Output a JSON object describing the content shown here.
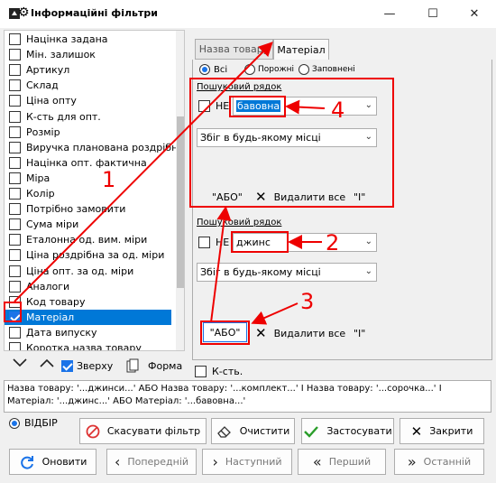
{
  "window": {
    "title": "Інформаційні фільтри",
    "controls": [
      "—",
      "☐",
      "✕"
    ]
  },
  "field_list": {
    "items": [
      {
        "label": "Націнка задана",
        "checked": false
      },
      {
        "label": "Мін. залишок",
        "checked": false
      },
      {
        "label": "Артикул",
        "checked": false
      },
      {
        "label": "Склад",
        "checked": false
      },
      {
        "label": "Ціна опту",
        "checked": false
      },
      {
        "label": "К-сть для опт.",
        "checked": false
      },
      {
        "label": "Розмір",
        "checked": false
      },
      {
        "label": "Виручка планована роздрібна з",
        "checked": false
      },
      {
        "label": "Націнка опт. фактична",
        "checked": false
      },
      {
        "label": "Міра",
        "checked": false
      },
      {
        "label": "Колір",
        "checked": false
      },
      {
        "label": "Потрібно замовити",
        "checked": false
      },
      {
        "label": "Сума міри",
        "checked": false
      },
      {
        "label": "Еталонна од. вим. міри",
        "checked": false
      },
      {
        "label": "Ціна роздрібна за од. міри",
        "checked": false
      },
      {
        "label": "Ціна опт. за од. міри",
        "checked": false
      },
      {
        "label": "Аналоги",
        "checked": false
      },
      {
        "label": "Код товару",
        "checked": false
      },
      {
        "label": "Матеріал",
        "checked": true,
        "selected": true
      },
      {
        "label": "Дата випуску",
        "checked": false
      },
      {
        "label": "Коротка назва товару",
        "checked": false
      }
    ]
  },
  "list_toolbar": {
    "up_icon": "chevron-up-icon",
    "down_icon": "chevron-down-icon",
    "top_label": "Зверху",
    "top_checked": true,
    "form_label": "Форма"
  },
  "tabs": [
    {
      "label": "Назва товару",
      "active": false
    },
    {
      "label": "Матеріал",
      "active": true
    }
  ],
  "mode": {
    "options": [
      "Всі",
      "Порожні",
      "Заповнені"
    ],
    "selected": "Всі"
  },
  "search1": {
    "label": "Пошуковий рядок",
    "not_label": "НЕ",
    "value": "бавовна",
    "match_mode": "Збіг в будь-якому місці",
    "or_label": "\"АБО\"",
    "delete_label": "Видалити все",
    "and_label": "\"І\""
  },
  "search2": {
    "label": "Пошуковий рядок",
    "not_label": "НЕ",
    "value": "джинс",
    "match_mode": "Збіг в будь-якому місці",
    "or_label": "\"АБО\"",
    "delete_label": "Видалити все",
    "and_label": "\"І\""
  },
  "count_label": "К-сть.",
  "filter_text": "Назва товару: '...джинси...' АБО Назва товару: '...комплект...' І Назва товару: '...сорочка...' І\nМатеріал: '...джинс...' АБО Матеріал: '...бавовна...'",
  "selection_mode": "ВІДБІР",
  "actions": {
    "cancel": "Скасувати фільтр",
    "clear": "Очистити",
    "apply": "Застосувати",
    "close": "Закрити",
    "refresh": "Оновити",
    "prev": "Попередній",
    "next": "Наступний",
    "first": "Перший",
    "last": "Останній"
  },
  "annotations": [
    "1",
    "2",
    "3",
    "4"
  ],
  "colors": {
    "accent": "#0078d7",
    "annotation": "#e00000",
    "check": "#1a73e8"
  }
}
